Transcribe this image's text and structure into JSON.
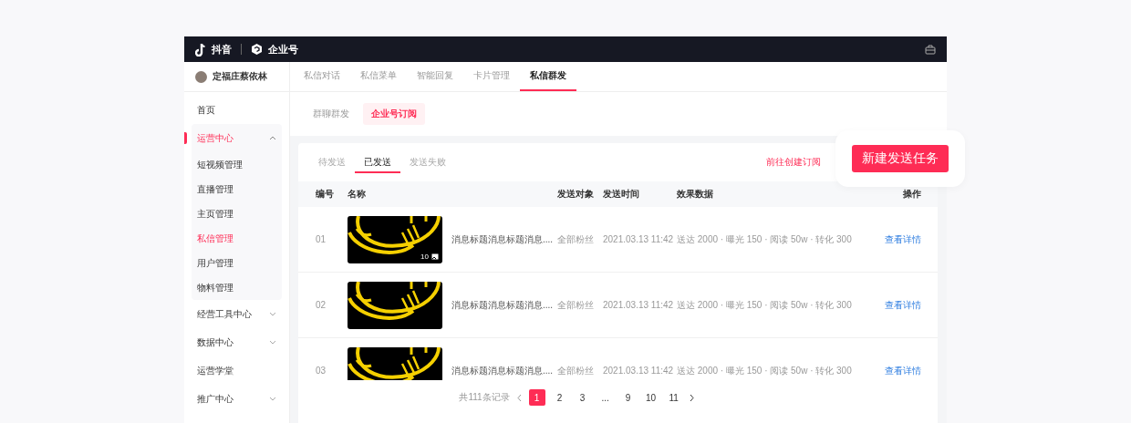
{
  "topbar": {
    "brand": "抖音",
    "product": "企业号"
  },
  "sidebar": {
    "account": {
      "name": "定福庄蔡依林"
    },
    "items": [
      {
        "label": "首页",
        "selected": false
      },
      {
        "label": "运营中心",
        "selected": true,
        "expanded": true,
        "children": [
          {
            "label": "短视频管理",
            "selected": false
          },
          {
            "label": "直播管理",
            "selected": false
          },
          {
            "label": "主页管理",
            "selected": false
          },
          {
            "label": "私信管理",
            "selected": true
          },
          {
            "label": "用户管理",
            "selected": false
          },
          {
            "label": "物料管理",
            "selected": false
          }
        ]
      },
      {
        "label": "经营工具中心",
        "selected": false,
        "expanded": false
      },
      {
        "label": "数据中心",
        "selected": false,
        "expanded": false
      },
      {
        "label": "运营学堂",
        "selected": false
      },
      {
        "label": "推广中心",
        "selected": false,
        "expanded": false
      }
    ]
  },
  "tabs": [
    {
      "label": "私信对话",
      "selected": false
    },
    {
      "label": "私信菜单",
      "selected": false
    },
    {
      "label": "智能回复",
      "selected": false
    },
    {
      "label": "卡片管理",
      "selected": false
    },
    {
      "label": "私信群发",
      "selected": true
    }
  ],
  "subtabs": [
    {
      "label": "群聊群发",
      "selected": false
    },
    {
      "label": "企业号订阅",
      "selected": true
    }
  ],
  "card": {
    "tabs": [
      {
        "label": "待发送",
        "selected": false
      },
      {
        "label": "已发送",
        "selected": true
      },
      {
        "label": "发送失败",
        "selected": false
      }
    ],
    "link": "前往创建订阅",
    "create_button": "新建发送任务",
    "table": {
      "columns": [
        "编号",
        "名称",
        "发送对象",
        "发送时间",
        "效果数据",
        "操作"
      ],
      "rows": [
        {
          "number": "01",
          "image_count": "10",
          "title": "消息标题消息标题消息....",
          "audience": "全部粉丝",
          "time": "2021.03.13 11:42",
          "stats": "送达 2000 · 曝光 150 · 阅读 50w · 转化 300",
          "action": "查看详情"
        },
        {
          "number": "02",
          "title": "消息标题消息标题消息....",
          "audience": "全部粉丝",
          "time": "2021.03.13 11:42",
          "stats": "送达 2000 · 曝光 150 · 阅读 50w · 转化 300",
          "action": "查看详情"
        },
        {
          "number": "03",
          "title": "消息标题消息标题消息....",
          "audience": "全部粉丝",
          "time": "2021.03.13 11:42",
          "stats": "送达 2000 · 曝光 150 · 阅读 50w · 转化 300",
          "action": "查看详情"
        }
      ]
    },
    "pagination": {
      "total": "共111条记录",
      "pages": [
        {
          "label": "1",
          "selected": true
        },
        {
          "label": "2",
          "selected": false
        },
        {
          "label": "3",
          "selected": false
        },
        {
          "label": "...",
          "selected": false
        },
        {
          "label": "9",
          "selected": false
        },
        {
          "label": "10",
          "selected": false
        },
        {
          "label": "11",
          "selected": false
        }
      ]
    }
  }
}
